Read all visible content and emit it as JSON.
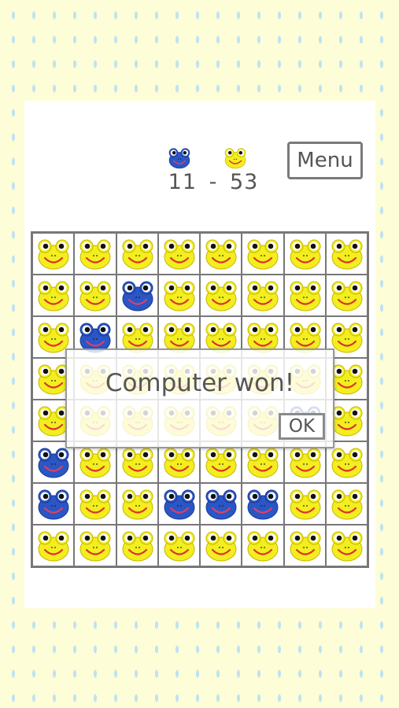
{
  "header": {
    "blue_score": "11",
    "separator": "-",
    "yellow_score": "53",
    "menu_label": "Menu",
    "blue_icon": "blue-frog-icon",
    "yellow_icon": "yellow-frog-icon"
  },
  "dialog": {
    "message": "Computer won!",
    "ok_label": "OK"
  },
  "board": {
    "rows": [
      "YYYYYYYY",
      "YYBYYYYY",
      "YBYYYYYY",
      "YYYYYYYY",
      "YYYYYYBY",
      "BYYYYYYY",
      "BYYBBBYY",
      "YYYYYYYY"
    ],
    "legend": {
      "B": "blue-frog",
      "Y": "yellow-frog"
    }
  },
  "colors": {
    "yellow_frog": "#f2ee1f",
    "blue_frog": "#2a56c6",
    "mouth": "#e0312b",
    "background": "#fdfdd8",
    "raindrop": "#bfe3f0"
  }
}
